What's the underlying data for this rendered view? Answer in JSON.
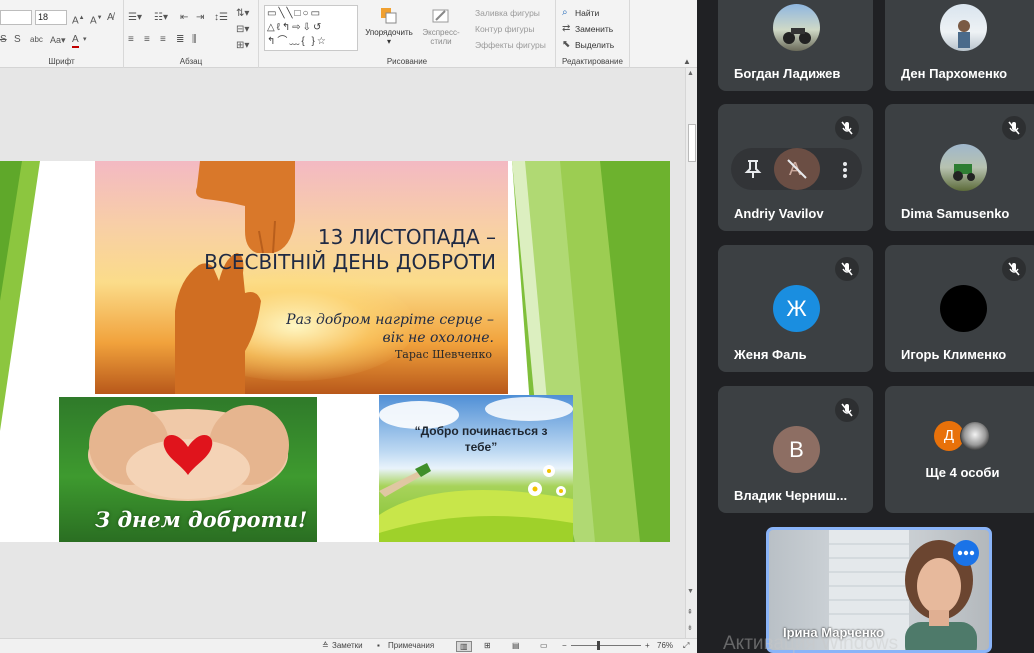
{
  "ribbon": {
    "font_size_value": "18",
    "font_group_label": "Шрифт",
    "paragraph_group_label": "Абзац",
    "drawing_group_label": "Рисование",
    "editing_group_label": "Редактирование",
    "arrange_label": "Упорядочить",
    "quick_styles_label": "Экспресс-стили",
    "shape_fill_label": "Заливка фигуры",
    "shape_outline_label": "Контур фигуры",
    "shape_effects_label": "Эффекты фигуры",
    "find_label": "Найти",
    "replace_label": "Заменить",
    "select_label": "Выделить"
  },
  "statusbar": {
    "notes_label": "Заметки",
    "comments_label": "Примечания",
    "zoom_label": "76%",
    "zoom_level": 76
  },
  "slide": {
    "title_line1": "13 ЛИСТОПАДА –",
    "title_line2": "ВСЕСВІТНІЙ ДЕНЬ ДОБРОТИ",
    "quote_line1": "Раз добром нагріте серце   –",
    "quote_line2": "вік не охолоне.",
    "quote_author": "Тарас Шевченко",
    "left_caption": "З днем доброти!",
    "right_caption_line1": "“Добро починається з",
    "right_caption_line2": "тебе”"
  },
  "meet": {
    "participants": [
      {
        "name": "Богдан Ладижев",
        "avatar": "photo"
      },
      {
        "name": "Ден Пархоменко",
        "avatar": "photo"
      },
      {
        "name": "Andriy Vavilov",
        "avatar": "photo",
        "muted": true
      },
      {
        "name": "Dima Samusenko",
        "avatar": "photo",
        "muted": true
      },
      {
        "name": "Женя Фаль",
        "avatar_letter": "Ж",
        "avatar_color": "#1a8ee0",
        "muted": true
      },
      {
        "name": "Игорь Клименко",
        "avatar_color": "#000000",
        "muted": true
      },
      {
        "name": "Владик Черниш...",
        "avatar_letter": "В",
        "avatar_color": "#8d6e63",
        "muted": true
      },
      {
        "name": "Ще 4 особи",
        "avatar_letter": "Д",
        "avatar_color": "#e8710a"
      }
    ],
    "self": {
      "name": "Ірина Марченко"
    },
    "watermark": "Активация Windows"
  }
}
